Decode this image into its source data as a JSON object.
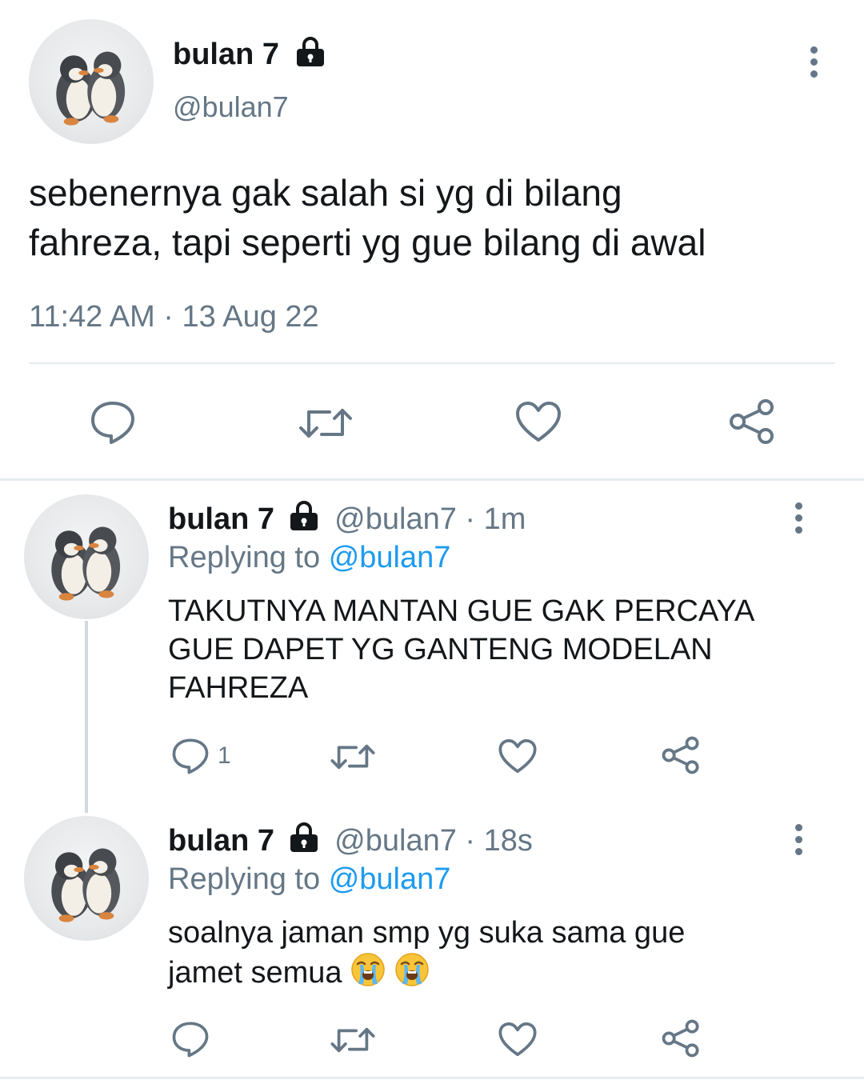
{
  "main_tweet": {
    "display_name": "bulan 7",
    "handle": "@bulan7",
    "text_line1": "sebenernya gak salah si yg di bilang",
    "text_line2": "fahreza, tapi seperti yg gue bilang di awal",
    "timestamp": "11:42 AM · 13 Aug 22"
  },
  "replies": [
    {
      "display_name": "bulan 7",
      "handle_time": "@bulan7 · 1m",
      "replying_prefix": "Replying to",
      "replying_to": "@bulan7",
      "text_line1": "TAKUTNYA MANTAN GUE GAK PERCAYA",
      "text_line2": "GUE DAPET YG GANTENG MODELAN",
      "text_line3": "FAHREZA",
      "reply_count": "1"
    },
    {
      "display_name": "bulan 7",
      "handle_time": "@bulan7 · 18s",
      "replying_prefix": "Replying to",
      "replying_to": "@bulan7",
      "text_line1": "soalnya jaman smp yg suka sama gue",
      "text_line2": "jamet semua"
    }
  ],
  "icons": {
    "lock": "lock-icon",
    "more": "more-vertical-icon",
    "reply": "reply-icon",
    "retweet": "retweet-icon",
    "like": "heart-icon",
    "share": "share-icon",
    "emoji": "loudly-crying-face-emoji"
  },
  "colors": {
    "link": "#1d9bf0",
    "muted": "#657786",
    "text": "#14171a",
    "divider": "#e6ecf0"
  }
}
